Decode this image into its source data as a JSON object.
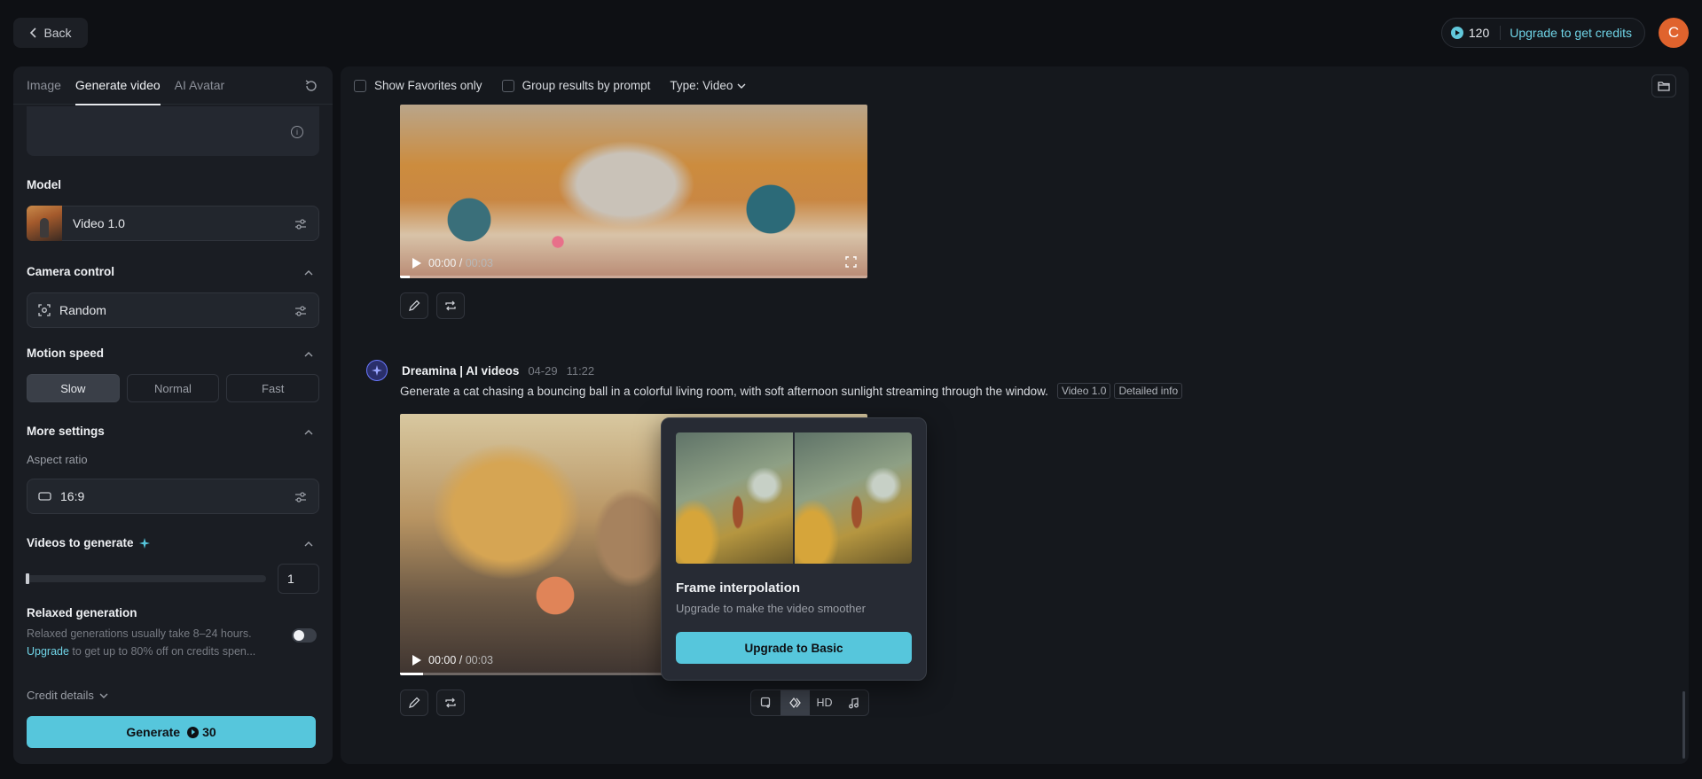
{
  "topbar": {
    "back_label": "Back",
    "credits": "120",
    "upgrade_label": "Upgrade to get credits",
    "avatar_initial": "C"
  },
  "left": {
    "tabs": [
      {
        "label": "Image"
      },
      {
        "label": "Generate video"
      },
      {
        "label": "AI Avatar"
      }
    ],
    "model_label": "Model",
    "model_value": "Video 1.0",
    "camera_label": "Camera control",
    "camera_value": "Random",
    "motion_label": "Motion speed",
    "speeds": [
      "Slow",
      "Normal",
      "Fast"
    ],
    "selected_speed": "Slow",
    "more_label": "More settings",
    "aspect_label": "Aspect ratio",
    "aspect_value": "16:9",
    "videos_label": "Videos to generate",
    "videos_count": "1",
    "relaxed_label": "Relaxed generation",
    "relaxed_desc_1": "Relaxed generations usually take 8–24 hours.",
    "relaxed_link": "Upgrade",
    "relaxed_desc_2": " to get up to 80% off on credits spen...",
    "credit_details": "Credit details",
    "generate_label": "Generate",
    "generate_cost": "30"
  },
  "main": {
    "show_favorites": "Show Favorites only",
    "group_results": "Group results by prompt",
    "type_filter": "Type: Video",
    "video1": {
      "time": "00:00",
      "duration": "00:03"
    },
    "gen": {
      "name": "Dreamina | AI videos",
      "date": "04-29",
      "time": "11:22",
      "prompt": "Generate a cat chasing a bouncing ball in a colorful living room, with soft afternoon sunlight streaming through the window.",
      "model_tag": "Video 1.0",
      "info_tag": "Detailed info"
    },
    "video2": {
      "time": "00:00",
      "duration": "00:03"
    },
    "hd_label": "HD",
    "popup": {
      "title": "Frame interpolation",
      "desc": "Upgrade to make the video smoother",
      "button": "Upgrade to Basic"
    }
  },
  "colors": {
    "accent": "#56c6dc",
    "avatar": "#e0632d",
    "background": "#0e1014",
    "panel": "#1a1d23"
  }
}
